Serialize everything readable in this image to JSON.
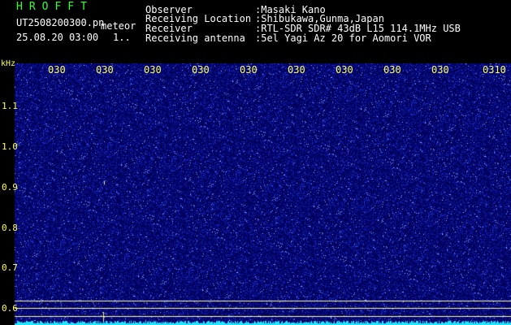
{
  "header": {
    "logo": "HROFFT",
    "file_name": "UT2508200300.pn",
    "mode": "meteor",
    "datetime": "25.08.20 03:00",
    "counter": "1..",
    "info": [
      {
        "label": "Observer",
        "value": ":Masaki Kano"
      },
      {
        "label": "Receiving Location",
        "value": ":Shibukawa,Gunma,Japan"
      },
      {
        "label": "Receiver",
        "value": ":RTL-SDR SDR# 43dB L15 114.1MHz USB"
      },
      {
        "label": "Receiving antenna",
        "value": ":5el Yagi Az 20 for Aomori VOR"
      }
    ]
  },
  "time_axis": {
    "ticks": [
      "030",
      "030",
      "030",
      "030",
      "030",
      "030",
      "030",
      "030",
      "030",
      "0310"
    ]
  },
  "freq_axis": {
    "unit": "kHz",
    "labels": [
      "1.1",
      "1.0",
      "0.9",
      "0.8",
      "0.7",
      "0.6"
    ]
  },
  "colors": {
    "logo": "#34ff34",
    "text": "#ffffff",
    "axis_ticks": "#ffff52",
    "freq_labels": "#ffff52",
    "spectrum_bg": "#00005a",
    "noise_speckle": "#2b3cff",
    "reference_line": "#ffff9a",
    "bottom_trace": "#20e6ff",
    "meteor_echo": "#fff27a"
  }
}
